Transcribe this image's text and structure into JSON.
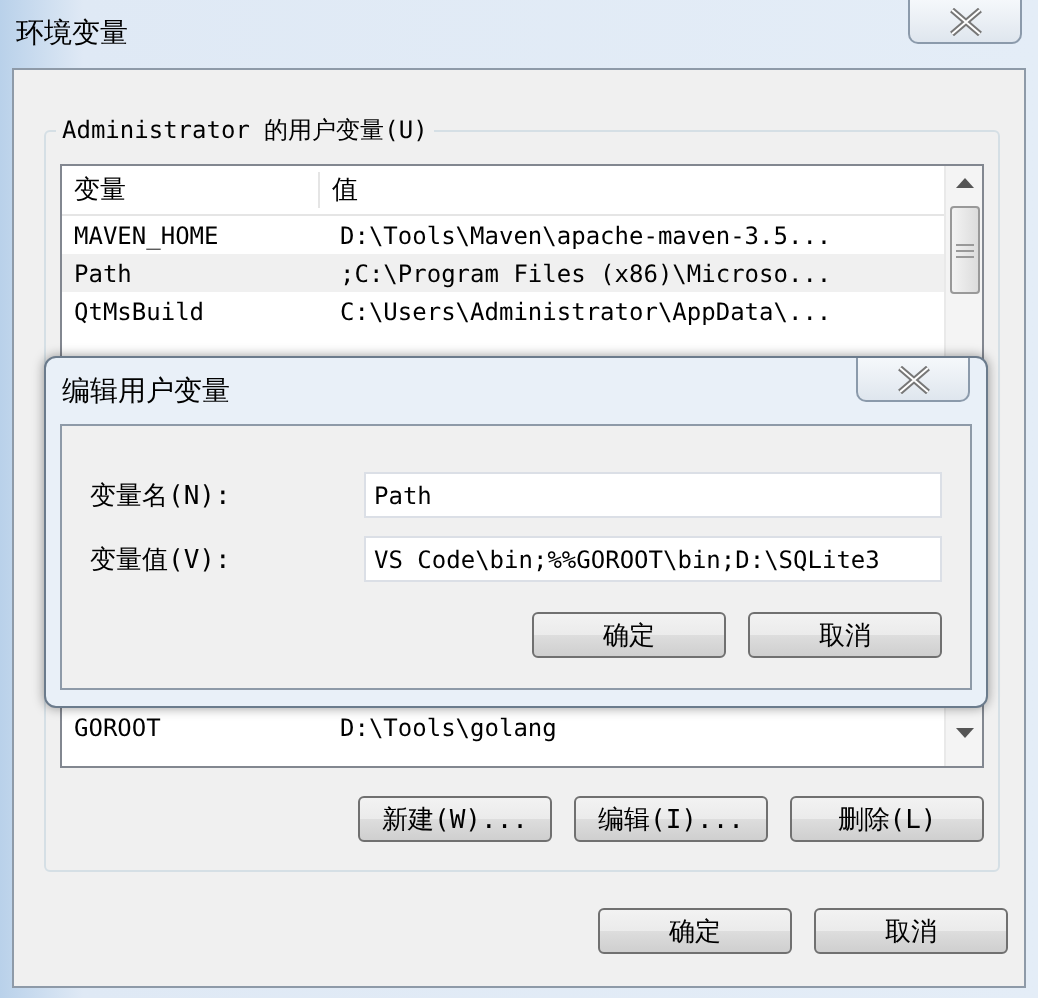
{
  "window": {
    "title": "环境变量"
  },
  "user_variables": {
    "title": "Administrator 的用户变量(U)",
    "columns": [
      "变量",
      "值"
    ],
    "rows": [
      {
        "name": "MAVEN_HOME",
        "value": "D:\\Tools\\Maven\\apache-maven-3.5...",
        "selected": false
      },
      {
        "name": "Path",
        "value": ";C:\\Program Files (x86)\\Microso...",
        "selected": true
      },
      {
        "name": "QtMsBuild",
        "value": "C:\\Users\\Administrator\\AppData\\...",
        "selected": false
      },
      {
        "name": "GOROOT",
        "value": "D:\\Tools\\golang",
        "selected": false
      }
    ],
    "buttons": [
      "新建(W)...",
      "编辑(I)...",
      "删除(L)"
    ]
  },
  "buttons": [
    "确定",
    "取消"
  ],
  "edit_dialog": {
    "title": "编辑用户变量",
    "fields": [
      {
        "label": "变量名(N):",
        "value": "Path"
      },
      {
        "label": "变量值(V):",
        "value": "VS Code\\bin;%%GOROOT\\bin;D:\\SQLite3"
      }
    ],
    "buttons": [
      "确定",
      "取消"
    ]
  }
}
